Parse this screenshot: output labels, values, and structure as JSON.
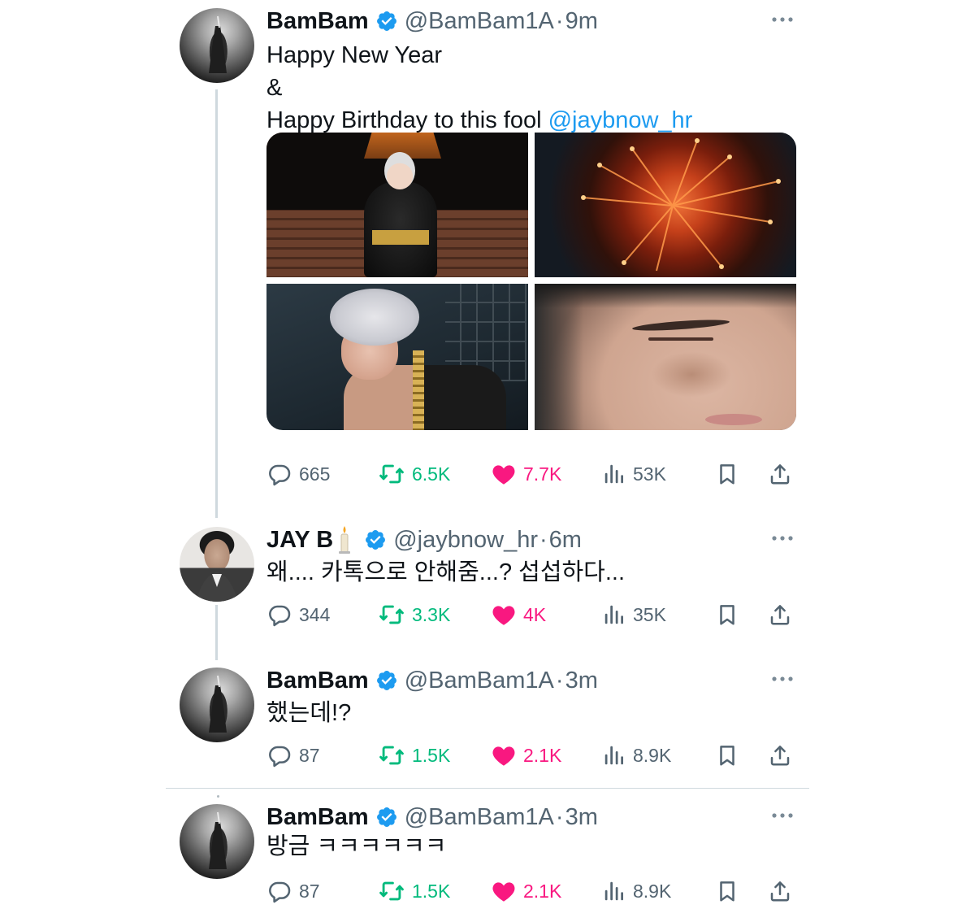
{
  "colors": {
    "text": "#0f1419",
    "secondary": "#536471",
    "link": "#1d9bf0",
    "verified": "#1d9bf0",
    "retweet": "#00ba7c",
    "like": "#f91880",
    "thread_line": "#cfd9de"
  },
  "tweets": [
    {
      "name": "BamBam",
      "handle": "@BamBam1A",
      "separator": "·",
      "time": "9m",
      "text_lines": [
        "Happy New Year",
        "&"
      ],
      "text_last_prefix": "Happy Birthday to this fool ",
      "mention": "@jaybnow_hr",
      "has_media": true,
      "media_count": 4,
      "replies": "665",
      "retweets": "6.5K",
      "likes": "7.7K",
      "views": "53K",
      "liked": true,
      "retweeted": true
    },
    {
      "name": "JAY B",
      "name_emoji": "candle",
      "handle": "@jaybnow_hr",
      "separator": "·",
      "time": "6m",
      "text": "왜.... 카톡으로 안해줌...? 섭섭하다...",
      "replies": "344",
      "retweets": "3.3K",
      "likes": "4K",
      "views": "35K",
      "liked": true,
      "retweeted": true
    },
    {
      "name": "BamBam",
      "handle": "@BamBam1A",
      "separator": "·",
      "time": "3m",
      "text": "했는데!?",
      "replies": "87",
      "retweets": "1.5K",
      "likes": "2.1K",
      "views": "8.9K",
      "liked": true,
      "retweeted": true
    },
    {
      "name": "BamBam",
      "handle": "@BamBam1A",
      "separator": "·",
      "time": "3m",
      "text": "방금 ㅋㅋㅋㅋㅋㅋ",
      "replies": "87",
      "retweets": "1.5K",
      "likes": "2.1K",
      "views": "8.9K",
      "liked": true,
      "retweeted": true
    }
  ]
}
